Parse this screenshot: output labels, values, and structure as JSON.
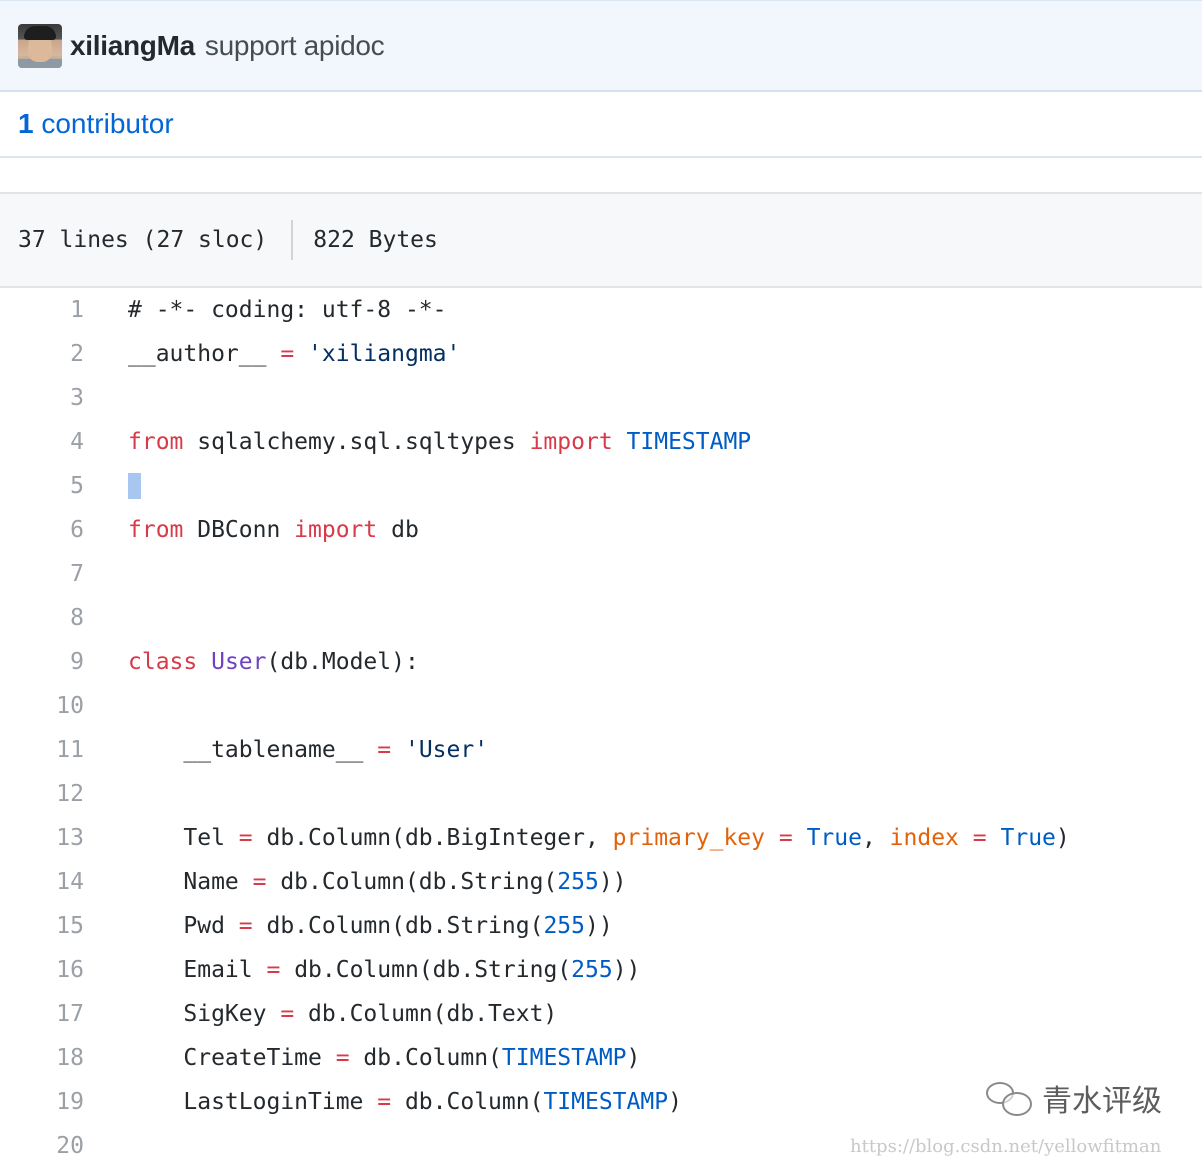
{
  "commit": {
    "author": "xiliangMa",
    "message": "support apidoc"
  },
  "contributors": {
    "count": "1",
    "label": "contributor"
  },
  "file": {
    "lines": "37 lines (27 sloc)",
    "size": "822 Bytes"
  },
  "code_lines": [
    {
      "n": "1",
      "text": "# -*- coding: utf-8 -*-"
    },
    {
      "n": "2",
      "text": "__author__ = 'xiliangma'"
    },
    {
      "n": "3",
      "text": ""
    },
    {
      "n": "4",
      "text": "from sqlalchemy.sql.sqltypes import TIMESTAMP"
    },
    {
      "n": "5",
      "text": ""
    },
    {
      "n": "6",
      "text": "from DBConn import db"
    },
    {
      "n": "7",
      "text": ""
    },
    {
      "n": "8",
      "text": ""
    },
    {
      "n": "9",
      "text": "class User(db.Model):"
    },
    {
      "n": "10",
      "text": ""
    },
    {
      "n": "11",
      "text": "    __tablename__ = 'User'"
    },
    {
      "n": "12",
      "text": ""
    },
    {
      "n": "13",
      "text": "    Tel = db.Column(db.BigInteger, primary_key = True, index = True)"
    },
    {
      "n": "14",
      "text": "    Name = db.Column(db.String(255))"
    },
    {
      "n": "15",
      "text": "    Pwd = db.Column(db.String(255))"
    },
    {
      "n": "16",
      "text": "    Email = db.Column(db.String(255))"
    },
    {
      "n": "17",
      "text": "    SigKey = db.Column(db.Text)"
    },
    {
      "n": "18",
      "text": "    CreateTime = db.Column(TIMESTAMP)"
    },
    {
      "n": "19",
      "text": "    LastLoginTime = db.Column(TIMESTAMP)"
    },
    {
      "n": "20",
      "text": ""
    }
  ],
  "watermark": {
    "brand": "青水评级",
    "url": "https://blog.csdn.net/yellowfitman"
  },
  "colors": {
    "keyword": "#d73a49",
    "class": "#6f42c1",
    "string": "#032f62",
    "constant": "#005cc5",
    "param": "#e36209",
    "link": "#0366d6"
  }
}
